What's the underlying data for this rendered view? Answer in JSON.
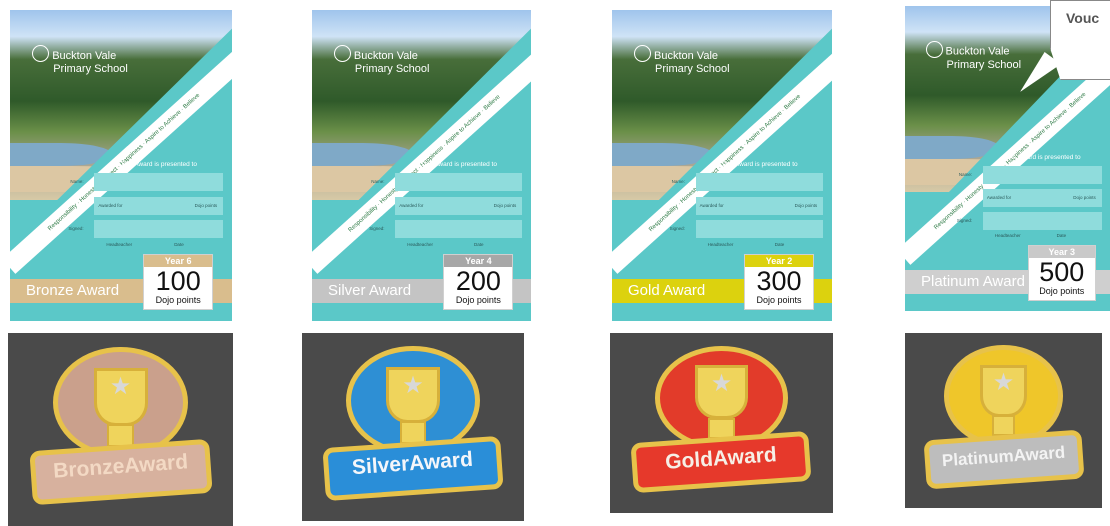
{
  "school_name_line1": "Buckton Vale",
  "school_name_line2": "Primary School",
  "values_text": "Responsibility · Honesty · Respect · Happiness · Aspire to Achieve · Believe",
  "presented_text": "This Award is presented to",
  "field_name": "Name:",
  "field_awarded_for": "Awarded for",
  "field_dojo_points": "Dojo points",
  "field_signed": "Signed:",
  "field_headteacher": "Headteacher",
  "field_date": "Date",
  "dojo_points_label": "Dojo points",
  "voucher_text": "Vouc",
  "certificates": [
    {
      "award": "Bronze Award",
      "year": "Year 6",
      "points": "100",
      "bar_color": "#d9bd8d",
      "year_color": "#d9bd8d"
    },
    {
      "award": "Silver Award",
      "year": "Year 4",
      "points": "200",
      "bar_color": "#c4c4c4",
      "year_color": "#a7a7a7"
    },
    {
      "award": "Gold Award",
      "year": "Year 2",
      "points": "300",
      "bar_color": "#dcd20e",
      "year_color": "#dcd20e"
    },
    {
      "award": "Platinum Award",
      "year": "Year 3",
      "points": "500",
      "bar_color": "#cfcfcf",
      "year_color": "#c9c9c9"
    }
  ],
  "badges": [
    {
      "text": "BronzeAward",
      "fill": "#caa08c",
      "ribbon": "#d7b19e",
      "text_color": "#f3d9c4"
    },
    {
      "text": "SilverAward",
      "fill": "#2e8fd4",
      "ribbon": "#2a8ed8",
      "text_color": "#f4f6fa"
    },
    {
      "text": "GoldAward",
      "fill": "#e23b2a",
      "ribbon": "#e6392b",
      "text_color": "#f6efe6"
    },
    {
      "text": "PlatinumAward",
      "fill": "#efc62a",
      "ribbon": "#bdbdbd",
      "text_color": "#f3f3f3"
    }
  ]
}
